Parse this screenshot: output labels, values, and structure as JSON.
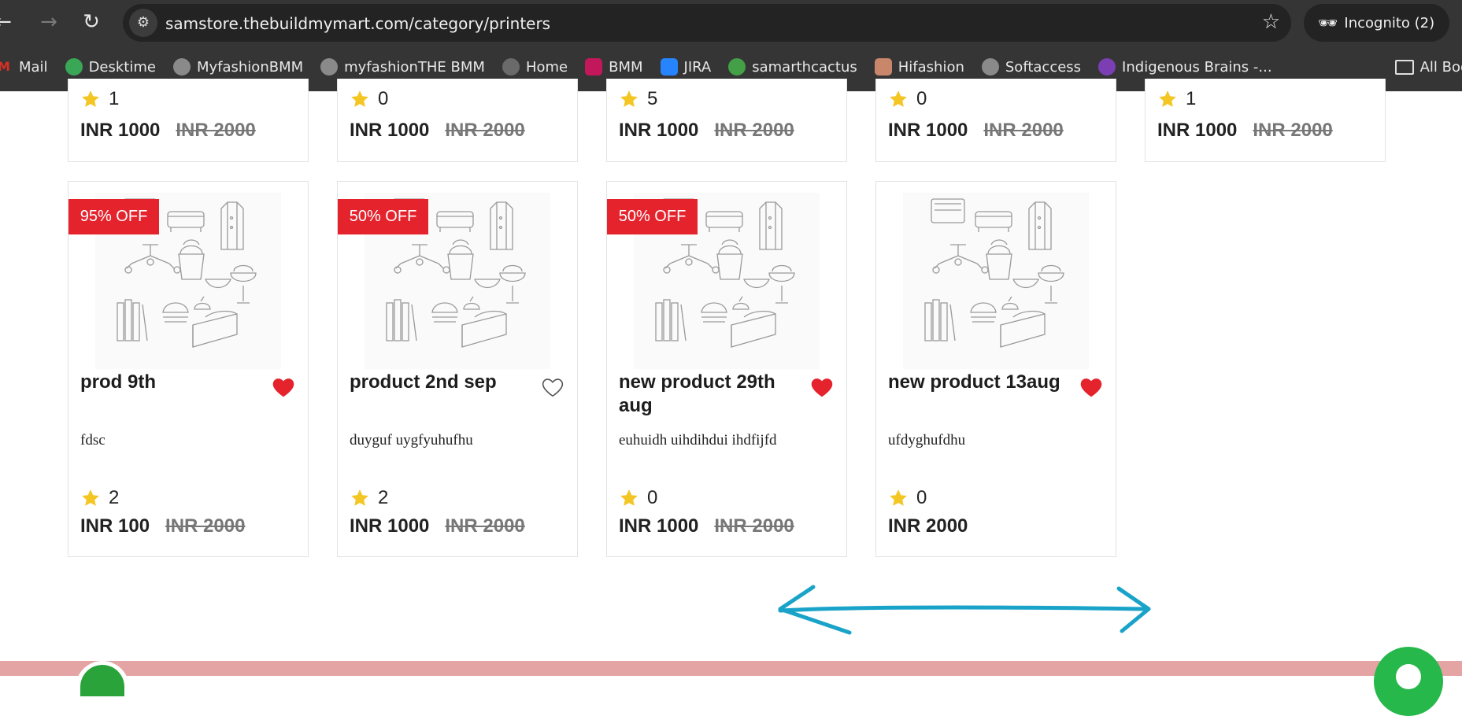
{
  "browser": {
    "url": "samstore.thebuildmymart.com/category/printers",
    "incognito_label": "Incognito (2)",
    "bookmarks": [
      {
        "label": "Mail",
        "icon": "gmail-icon",
        "color": "#d93025"
      },
      {
        "label": "Desktime",
        "icon": "desktime-icon",
        "color": "#3aa757"
      },
      {
        "label": "MyfashionBMM",
        "icon": "globe-icon",
        "color": "#8a8a8a"
      },
      {
        "label": "myfashionTHE BMM",
        "icon": "globe-icon",
        "color": "#8a8a8a"
      },
      {
        "label": "Home",
        "icon": "globe-icon",
        "color": "#6a6a6a"
      },
      {
        "label": "BMM",
        "icon": "bmm-icon",
        "color": "#c2185b"
      },
      {
        "label": "JIRA",
        "icon": "jira-icon",
        "color": "#2684ff"
      },
      {
        "label": "samarthcactus",
        "icon": "cactus-icon",
        "color": "#43a047"
      },
      {
        "label": "Hifashion",
        "icon": "hifashion-icon",
        "color": "#c8866a"
      },
      {
        "label": "Softaccess",
        "icon": "globe-icon",
        "color": "#8a8a8a"
      },
      {
        "label": "Indigenous Brains -...",
        "icon": "indigenous-icon",
        "color": "#7b3fb3"
      }
    ],
    "all_bookmarks_label": "All Bookmarks"
  },
  "top_row": [
    {
      "rating": "1",
      "price": "INR 1000",
      "old_price": "INR 2000"
    },
    {
      "rating": "0",
      "price": "INR 1000",
      "old_price": "INR 2000"
    },
    {
      "rating": "5",
      "price": "INR 1000",
      "old_price": "INR 2000"
    },
    {
      "rating": "0",
      "price": "INR 1000",
      "old_price": "INR 2000"
    },
    {
      "rating": "1",
      "price": "INR 1000",
      "old_price": "INR 2000"
    }
  ],
  "products": [
    {
      "badge": "95% OFF",
      "name": "prod 9th",
      "favorited": true,
      "description": "fdsc",
      "rating": "2",
      "price": "INR 100",
      "old_price": "INR 2000"
    },
    {
      "badge": "50% OFF",
      "name": "product 2nd sep",
      "favorited": false,
      "description": "duyguf uygfyuhufhu",
      "rating": "2",
      "price": "INR 1000",
      "old_price": "INR 2000"
    },
    {
      "badge": "50% OFF",
      "name": "new product 29th aug",
      "favorited": true,
      "description": "euhuidh uihdihdui ihdfijfd",
      "rating": "0",
      "price": "INR 1000",
      "old_price": "INR 2000"
    },
    {
      "badge": "",
      "name": "new product 13aug",
      "favorited": true,
      "description": "ufdyghufdhu",
      "rating": "0",
      "price": "INR 2000",
      "old_price": ""
    }
  ],
  "colors": {
    "badge": "#e4232d",
    "heart_filled": "#e4232d",
    "star": "#f3c623",
    "annotation_arrow": "#1aa3c9",
    "footer": "#e4a4a4",
    "chat": "#27b84b"
  }
}
